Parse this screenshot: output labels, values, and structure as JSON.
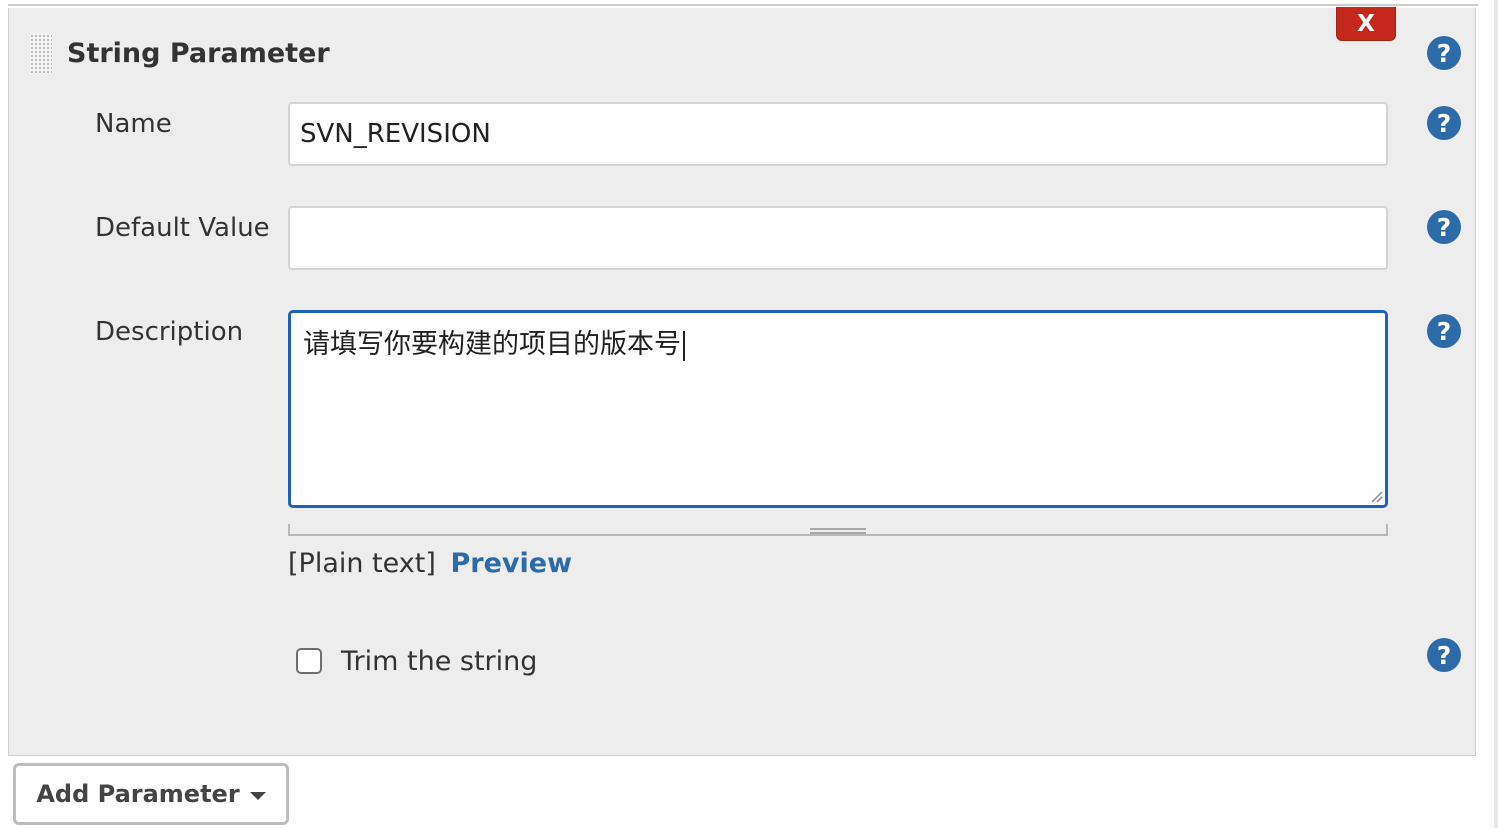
{
  "section": {
    "title": "String Parameter",
    "delete_label": "X"
  },
  "fields": {
    "name": {
      "label": "Name",
      "value": "SVN_REVISION"
    },
    "default_value": {
      "label": "Default Value",
      "value": ""
    },
    "description": {
      "label": "Description",
      "value": "请填写你要构建的项目的版本号"
    }
  },
  "format": {
    "plain_text": "[Plain text]",
    "preview": "Preview"
  },
  "trim": {
    "label": "Trim the string",
    "checked": false
  },
  "help_icon_glyph": "?",
  "add_parameter": {
    "label": "Add Parameter"
  },
  "colors": {
    "delete_button": "#c4271b",
    "help_icon": "#2c6aa8",
    "focus_border": "#1f63b8",
    "link": "#2c6aa8"
  }
}
